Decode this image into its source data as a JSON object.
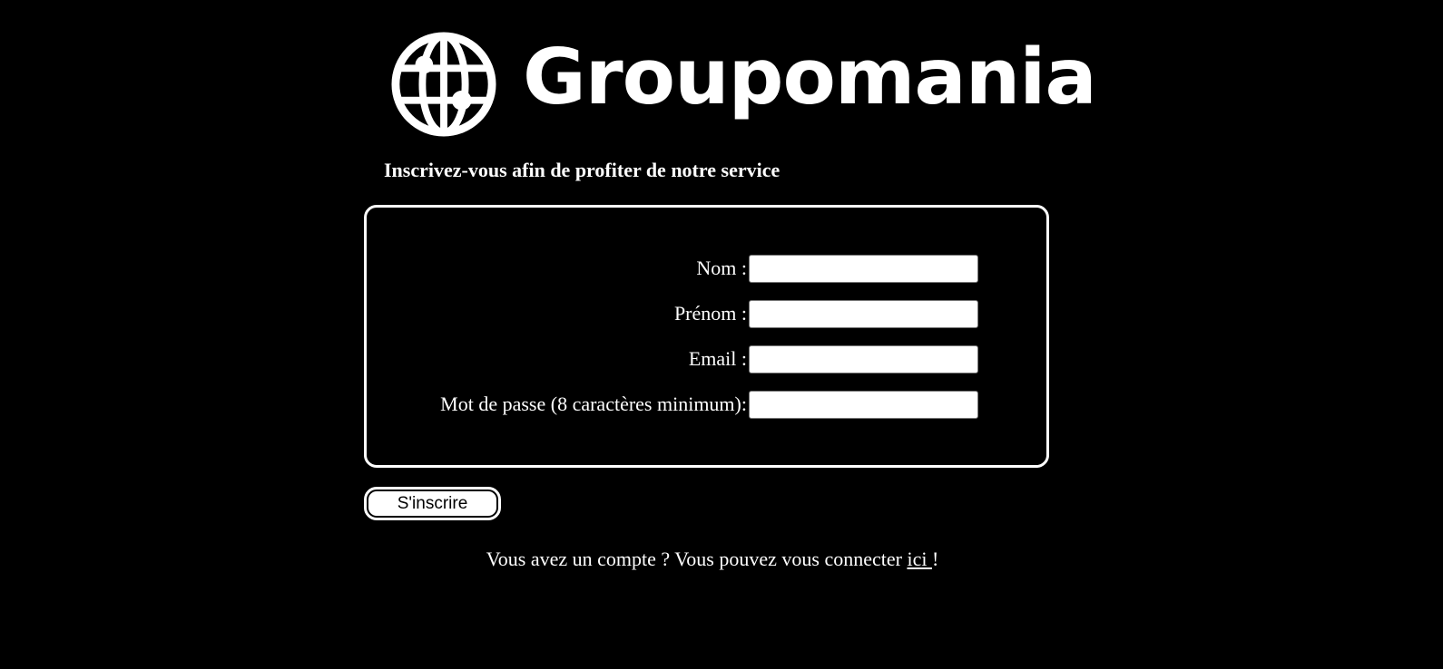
{
  "brand": {
    "name": "Groupomania",
    "icon": "globe-icon",
    "color": "#ffffff"
  },
  "subtitle": "Inscrivez-vous afin de profiter de notre service",
  "form": {
    "fields": [
      {
        "label": "Nom :",
        "value": "",
        "placeholder": ""
      },
      {
        "label": "Prénom :",
        "value": "",
        "placeholder": ""
      },
      {
        "label": "Email :",
        "value": "",
        "placeholder": ""
      },
      {
        "label": "Mot de passe (8 caractères minimum):",
        "value": "",
        "placeholder": ""
      }
    ],
    "submit_label": "S'inscrire"
  },
  "login_hint": {
    "prefix": "Vous avez un compte ? Vous pouvez vous connecter ",
    "link_text": "ici ",
    "suffix": "!"
  },
  "colors": {
    "background": "#000000",
    "foreground": "#ffffff"
  }
}
